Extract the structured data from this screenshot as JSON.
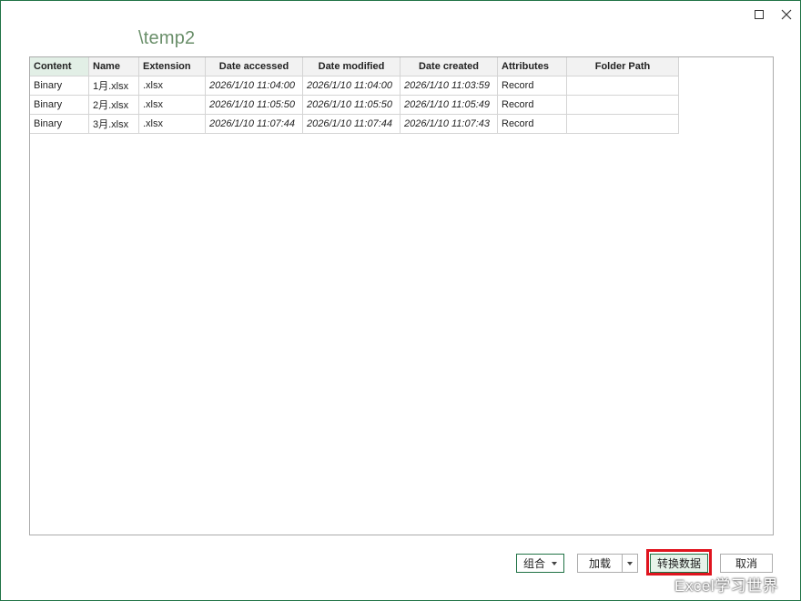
{
  "window": {
    "title": "\\temp2"
  },
  "table": {
    "columns": [
      "Content",
      "Name",
      "Extension",
      "Date accessed",
      "Date modified",
      "Date created",
      "Attributes",
      "Folder Path"
    ],
    "rows": [
      [
        "Binary",
        "1月.xlsx",
        ".xlsx",
        "2026/1/10 11:04:00",
        "2026/1/10 11:04:00",
        "2026/1/10 11:03:59",
        "Record",
        ""
      ],
      [
        "Binary",
        "2月.xlsx",
        ".xlsx",
        "2026/1/10 11:05:50",
        "2026/1/10 11:05:50",
        "2026/1/10 11:05:49",
        "Record",
        ""
      ],
      [
        "Binary",
        "3月.xlsx",
        ".xlsx",
        "2026/1/10 11:07:44",
        "2026/1/10 11:07:44",
        "2026/1/10 11:07:43",
        "Record",
        ""
      ]
    ]
  },
  "buttons": {
    "combine": "组合",
    "load": "加载",
    "transform": "转换数据",
    "cancel": "取消"
  },
  "watermark": "Excel学习世界",
  "colors": {
    "accent": "#217346",
    "highlight": "#e0141e",
    "title": "#6a8f6a"
  }
}
